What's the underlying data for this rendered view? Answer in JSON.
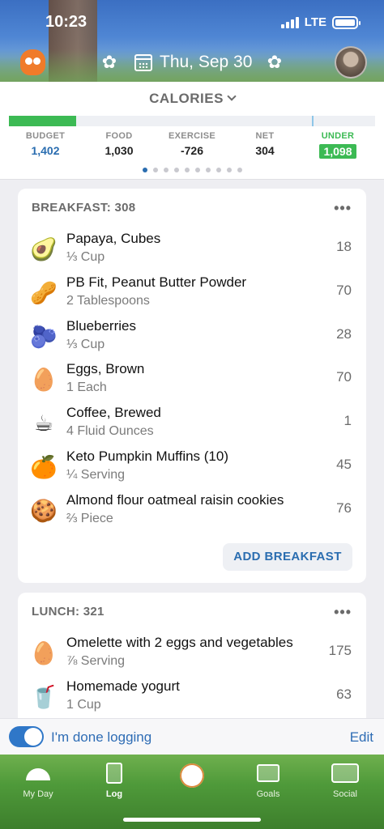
{
  "status": {
    "time": "10:23",
    "network": "LTE"
  },
  "header": {
    "date": "Thu, Sep 30"
  },
  "calories": {
    "title": "CALORIES",
    "progress": 0.183,
    "labels": {
      "budget": "BUDGET",
      "food": "FOOD",
      "exercise": "EXERCISE",
      "net": "NET",
      "under": "UNDER"
    },
    "values": {
      "budget": "1,402",
      "food": "1,030",
      "exercise": "-726",
      "net": "304",
      "under": "1,098"
    },
    "page_dots": 10,
    "active_dot": 0
  },
  "breakfast": {
    "title": "BREAKFAST: 308",
    "more": "•••",
    "items": [
      {
        "icon": "avocado",
        "emoji": "🥑",
        "name": "Papaya, Cubes",
        "serving": "⅓ Cup",
        "calories": "18"
      },
      {
        "icon": "jar",
        "emoji": "🥜",
        "name": "PB Fit, Peanut Butter Powder",
        "serving": "2 Tablespoons",
        "calories": "70"
      },
      {
        "icon": "blueberry",
        "emoji": "🫐",
        "name": "Blueberries",
        "serving": "⅓ Cup",
        "calories": "28"
      },
      {
        "icon": "egg",
        "emoji": "🥚",
        "name": "Eggs, Brown",
        "serving": "1 Each",
        "calories": "70"
      },
      {
        "icon": "coffee",
        "emoji": "☕",
        "name": "Coffee, Brewed",
        "serving": "4 Fluid Ounces",
        "calories": "1"
      },
      {
        "icon": "orange",
        "emoji": "🍊",
        "name": "Keto Pumpkin Muffins (10)",
        "serving": "¼ Serving",
        "calories": "45"
      },
      {
        "icon": "cookie",
        "emoji": "🍪",
        "name": "Almond flour oatmeal raisin cookies",
        "serving": "⅔ Piece",
        "calories": "76"
      }
    ],
    "add_label": "ADD BREAKFAST"
  },
  "lunch": {
    "title": "LUNCH: 321",
    "more": "•••",
    "items": [
      {
        "icon": "egg",
        "emoji": "🥚",
        "name": "Omelette with 2 eggs and vegetables",
        "serving": "⅞ Serving",
        "calories": "175"
      },
      {
        "icon": "cup",
        "emoji": "🥤",
        "name": "Homemade yogurt",
        "serving": "1 Cup",
        "calories": "63"
      }
    ]
  },
  "done_bar": {
    "label": "I'm done logging",
    "edit": "Edit",
    "toggle_on": true
  },
  "tabs": {
    "myday": "My Day",
    "log": "Log",
    "goals": "Goals",
    "social": "Social",
    "active": "Log"
  }
}
